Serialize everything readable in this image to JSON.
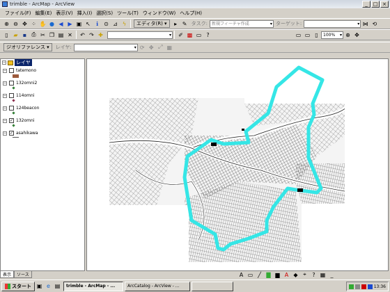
{
  "window": {
    "title": "trimble - ArcMap - ArcView"
  },
  "menu": [
    "ファイル(F)",
    "編集(E)",
    "表示(V)",
    "挿入(I)",
    "選択(S)",
    "ツール(T)",
    "ウィンドウ(W)",
    "ヘルプ(H)"
  ],
  "toolbar1": {
    "editor_label": "エディタ(R) ▾",
    "task_label": "タスク:",
    "task_value": "新規フィーチャ作成",
    "target_label": "ターゲット:",
    "target_value": ""
  },
  "toolbar2": {
    "scale_value": "",
    "zoom_value": "100%"
  },
  "toolbar3": {
    "georef_label": "ジオリファレンス ▾",
    "layer_label": "レイヤ:",
    "layer_value": ""
  },
  "toc": {
    "root_label": "レイヤ",
    "layers": [
      {
        "name": "tatemono",
        "checked": false,
        "color": "#9c5a3c"
      },
      {
        "name": "132omni2",
        "checked": false,
        "color": "#2e7d32"
      },
      {
        "name": "114omni",
        "checked": false,
        "color": "#8b2a4a"
      },
      {
        "name": "124beacon",
        "checked": false,
        "color": "#2e7d32"
      },
      {
        "name": "132omni",
        "checked": true,
        "color": "#2e7d32"
      },
      {
        "name": "asahikawa",
        "checked": true,
        "color": "#555555"
      }
    ],
    "tabs": [
      "表示",
      "ソース"
    ]
  },
  "colors": {
    "route": "#35e6e6",
    "titlebar": "#e8ecf1",
    "selection": "#0a246a"
  },
  "taskbar": {
    "start_label": "スタート",
    "tasks": [
      "trimble - ArcMap - ...",
      "ArcCatalog - ArcView - ...",
      ""
    ],
    "clock": "13:36"
  }
}
